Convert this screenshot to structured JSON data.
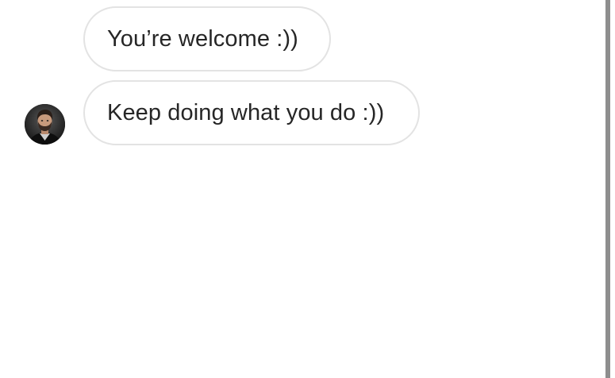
{
  "messages": [
    {
      "text": "You’re welcome :))"
    },
    {
      "text": "Keep doing what you do :))"
    }
  ],
  "avatar": {
    "icon": "user-profile-photo-icon"
  }
}
